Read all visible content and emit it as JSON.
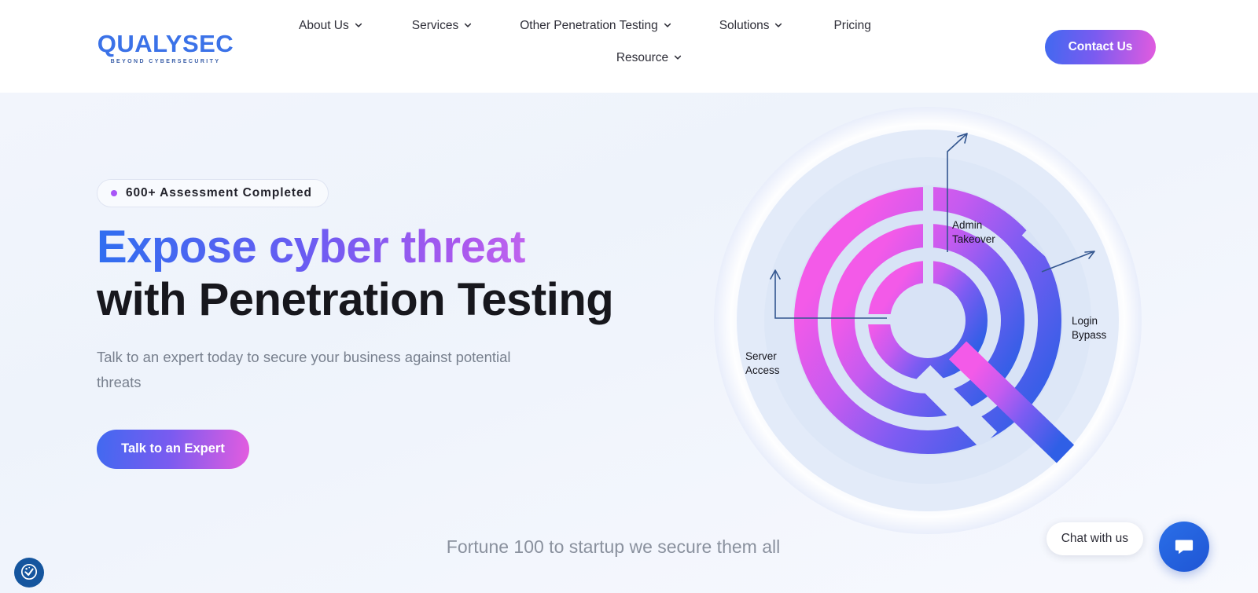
{
  "header": {
    "logo": {
      "wordmark": "QUALYSEC",
      "tagline": "BEYOND CYBERSECURITY"
    },
    "nav": [
      {
        "label": "About Us",
        "icon": "chevron-down-icon",
        "has_dropdown": true
      },
      {
        "label": "Services",
        "icon": "chevron-down-icon",
        "has_dropdown": true
      },
      {
        "label": "Other Penetration Testing",
        "icon": "chevron-down-icon",
        "has_dropdown": true
      },
      {
        "label": "Solutions",
        "icon": "chevron-down-icon",
        "has_dropdown": true
      },
      {
        "label": "Pricing",
        "has_dropdown": false
      },
      {
        "label": "Resource",
        "icon": "chevron-down-icon",
        "has_dropdown": true
      }
    ],
    "contact_button": "Contact Us"
  },
  "hero": {
    "badge": {
      "text": "600+ Assessment Completed",
      "dot_color": "#a855f7"
    },
    "headline_line1": "Expose cyber threat",
    "headline_line2": "with Penetration Testing",
    "subtitle": "Talk to an expert today to secure your business against potential threats",
    "cta_button": "Talk to an Expert",
    "bottom_tagline": "Fortune 100 to startup we secure them all"
  },
  "graphic": {
    "labels": [
      {
        "id": "admin",
        "line1": "Admin",
        "line2": "Takeover"
      },
      {
        "id": "login",
        "line1": "Login",
        "line2": "Bypass"
      },
      {
        "id": "server",
        "line1": "Server",
        "line2": "Access"
      }
    ],
    "colors": {
      "gradient_start": "#e85cea",
      "gradient_mid": "#8a5cf0",
      "gradient_end": "#3a63e8",
      "arrow": "#2f5aa8",
      "ring_bg": "#dbe5f7"
    }
  },
  "chat": {
    "tooltip": "Chat with us",
    "button_icon": "chat-bubble-icon",
    "button_color": "#2260dc"
  },
  "accessibility": {
    "button_icon": "accessibility-cookie-icon",
    "button_color": "#15559e"
  },
  "theme": {
    "brand_blue": "#3b72e8",
    "accent_gradient_from": "#4169f0",
    "accent_gradient_to": "#e45cdf",
    "hero_background": "#f2f5fc",
    "text_dark": "#17171d",
    "text_muted": "#78808e"
  }
}
